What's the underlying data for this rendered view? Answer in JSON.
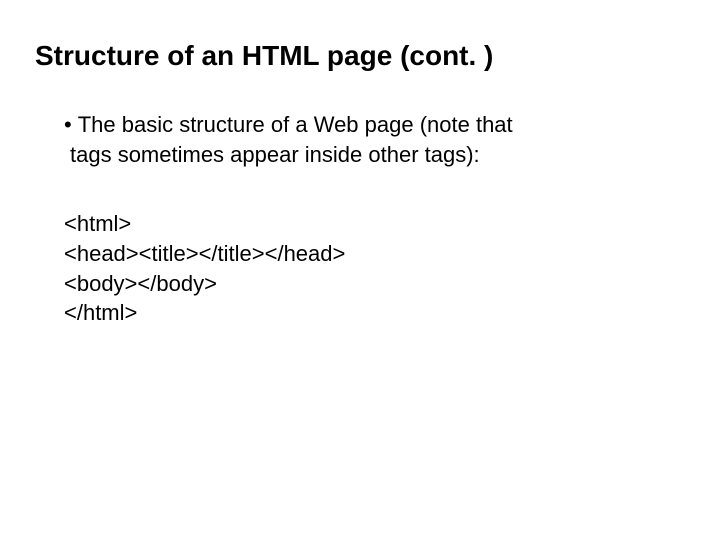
{
  "title": "Structure of an HTML page (cont. )",
  "bullet": {
    "marker": "•",
    "line1": "The basic structure of a Web page (note that",
    "line2": "tags sometimes appear inside other tags):"
  },
  "code": {
    "line1": "<html>",
    "line2": "<head><title></title></head>",
    "line3": "<body></body>",
    "line4": "</html>"
  }
}
